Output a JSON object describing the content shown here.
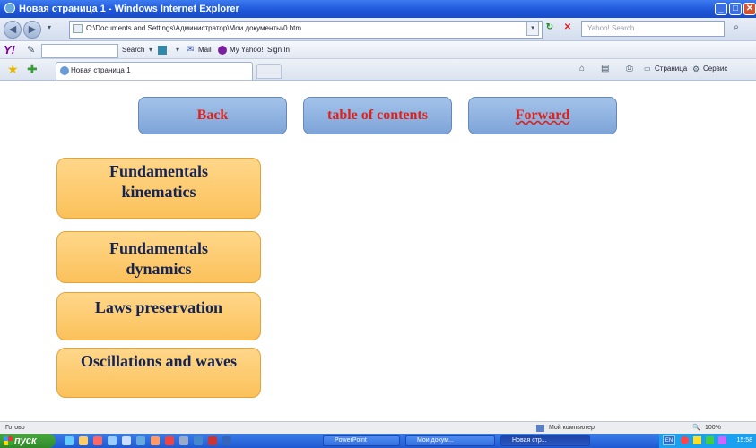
{
  "window": {
    "title": "Новая страница 1 - Windows Internet Explorer"
  },
  "address_bar": {
    "url": "C:\\Documents and Settings\\Администратор\\Мои документы\\0.htm",
    "search_placeholder": "Yahoo! Search"
  },
  "yahoo_toolbar": {
    "logo": "Y!",
    "search_label": "Search",
    "mail_label": "Mail",
    "myyahoo_label": "My Yahoo!",
    "signin_label": "Sign In"
  },
  "tab": {
    "title": "Новая страница 1",
    "page_menu": "Страница",
    "tools_menu": "Сервис"
  },
  "nav": {
    "back_label": "Back",
    "toc_label": "table of contents",
    "forward_label": "Forward"
  },
  "topics": [
    {
      "label": "Fundamentals kinematics"
    },
    {
      "label": "Fundamentals dynamics"
    },
    {
      "label": "Laws preservation"
    },
    {
      "label": "Oscillations and waves"
    }
  ],
  "status_bar": {
    "status_text": "Готово",
    "zone_text": "Мой компьютер",
    "zoom": "100%"
  },
  "taskbar": {
    "start_label": "пуск",
    "tasks": [
      {
        "label": "PowerPoint"
      },
      {
        "label": "Мои докум..."
      },
      {
        "label": "Новая стр..."
      }
    ],
    "language": "EN",
    "clock": "15:58"
  }
}
